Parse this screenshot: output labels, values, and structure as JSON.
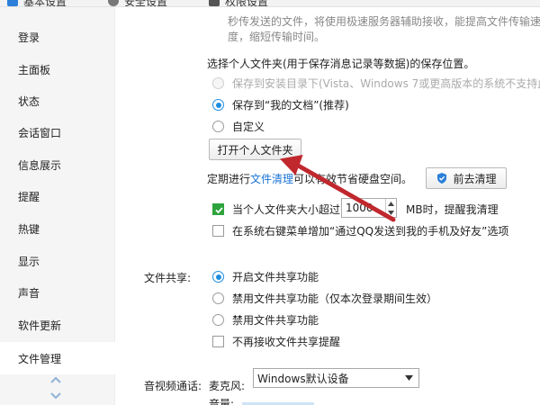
{
  "tabs": {
    "basic": "基本设置",
    "security": "安全设置",
    "permission": "权限设置"
  },
  "sidebar": {
    "items": [
      {
        "label": "登录"
      },
      {
        "label": "主面板"
      },
      {
        "label": "状态"
      },
      {
        "label": "会话窗口"
      },
      {
        "label": "信息展示"
      },
      {
        "label": "提醒"
      },
      {
        "label": "热键"
      },
      {
        "label": "显示"
      },
      {
        "label": "声音"
      },
      {
        "label": "软件更新"
      },
      {
        "label": "文件管理"
      }
    ],
    "active_index": 10
  },
  "content": {
    "desc_line1": "秒传发送的文件，将使用极速服务器辅助接收，能提高文件传输速",
    "desc_line2": "度，缩短传输时间。",
    "personal_folder_heading": "选择个人文件夹(用于保存消息记录等数据)的保存位置。",
    "radio_install_dir": "保存到安装目录下(Vista、Windows 7或更高版本的系统不支持此",
    "radio_my_docs": "保存到“我的文档”(推荐)",
    "radio_custom": "自定义",
    "open_folder_button": "打开个人文件夹",
    "cleanup_prefix": "定期进行",
    "cleanup_link": "文件清理",
    "cleanup_suffix": "可以有效节省硬盘空间。",
    "cleanup_button": "前去清理",
    "size_limit_prefix": "当个人文件夹大小超过",
    "size_limit_value": "1000",
    "size_limit_suffix": "MB时，提醒我清理",
    "context_menu_option": "在系统右键菜单增加“通过QQ发送到我的手机及好友”选项",
    "file_share_label": "文件共享:",
    "share_enable": "开启文件共享功能",
    "share_disable_session": "禁用文件共享功能（仅本次登录期间生效）",
    "share_disable": "禁用文件共享功能",
    "share_no_reminder": "不再接收文件共享提醒",
    "av_call_label": "音视频通话:",
    "mic_label": "麦克风:",
    "mic_device": "Windows默认设备",
    "volume_label": "音量:"
  },
  "colors": {
    "accent": "#1e8de0",
    "link": "#1a73d4",
    "arrow": "#c0282d",
    "check_green": "#2ea43d"
  }
}
